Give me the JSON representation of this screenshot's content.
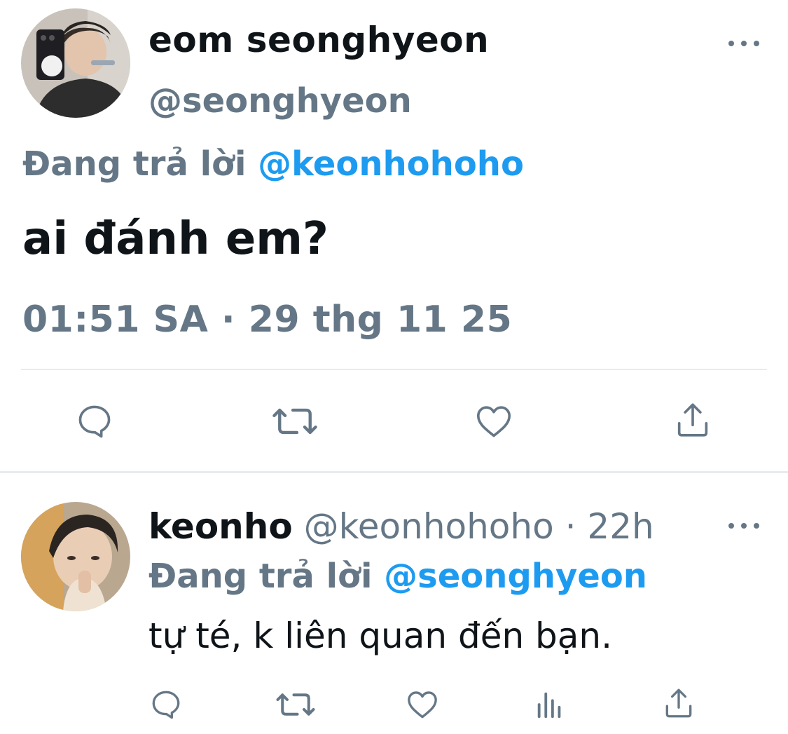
{
  "main_tweet": {
    "author_name": "eom seonghyeon",
    "author_handle": "@seonghyeon",
    "replying_prefix": "Đang trả lời",
    "replying_to": "@keonhohoho",
    "text": "ai đánh em?",
    "timestamp": "01:51 SA · 29 thg 11 25",
    "actions": [
      "reply-icon",
      "retweet-icon",
      "like-icon",
      "share-icon"
    ]
  },
  "reply_tweet": {
    "author_name": "keonho",
    "author_handle": "@keonhohoho",
    "separator": "·",
    "time_ago": "22h",
    "replying_prefix": "Đang trả lời",
    "replying_to": "@seonghyeon",
    "text": "tự té, k liên quan đến bạn.",
    "actions": [
      "reply-icon",
      "retweet-icon",
      "like-icon",
      "analytics-icon",
      "share-icon"
    ]
  },
  "colors": {
    "text_primary": "#0f1419",
    "text_secondary": "#657786",
    "accent": "#1d9bf0",
    "divider": "#e6ecf0"
  }
}
